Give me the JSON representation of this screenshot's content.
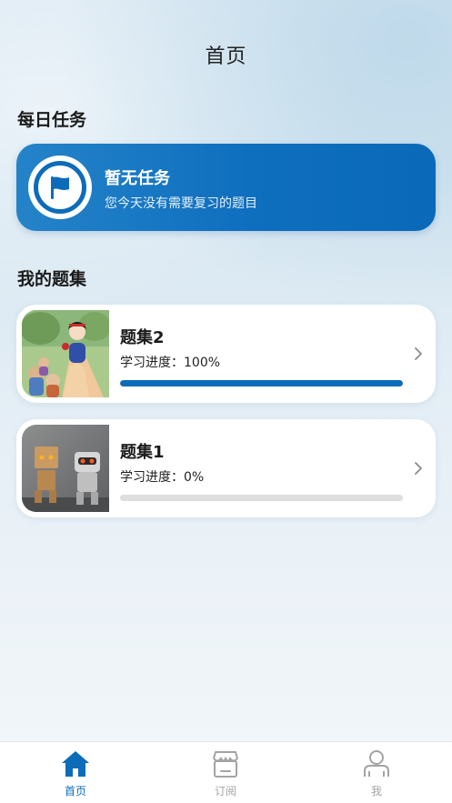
{
  "header": {
    "title": "首页"
  },
  "daily": {
    "section_title": "每日任务",
    "card": {
      "title": "暂无任务",
      "subtitle": "您今天没有需要复习的题目",
      "icon": "flag-icon"
    }
  },
  "sets": {
    "section_title": "我的题集",
    "items": [
      {
        "name": "题集2",
        "progress_label": "学习进度：100%",
        "progress": 1.0,
        "thumb": "snow-white-illustration"
      },
      {
        "name": "题集1",
        "progress_label": "学习进度：0%",
        "progress": 0.0,
        "thumb": "cardboard-robot-photo"
      }
    ]
  },
  "tabbar": {
    "items": [
      {
        "label": "首页",
        "icon": "home-icon",
        "active": true
      },
      {
        "label": "订阅",
        "icon": "store-icon",
        "active": false
      },
      {
        "label": "我",
        "icon": "person-icon",
        "active": false
      }
    ]
  },
  "colors": {
    "accent": "#0c6cb9",
    "inactive": "#a3a3a3"
  }
}
